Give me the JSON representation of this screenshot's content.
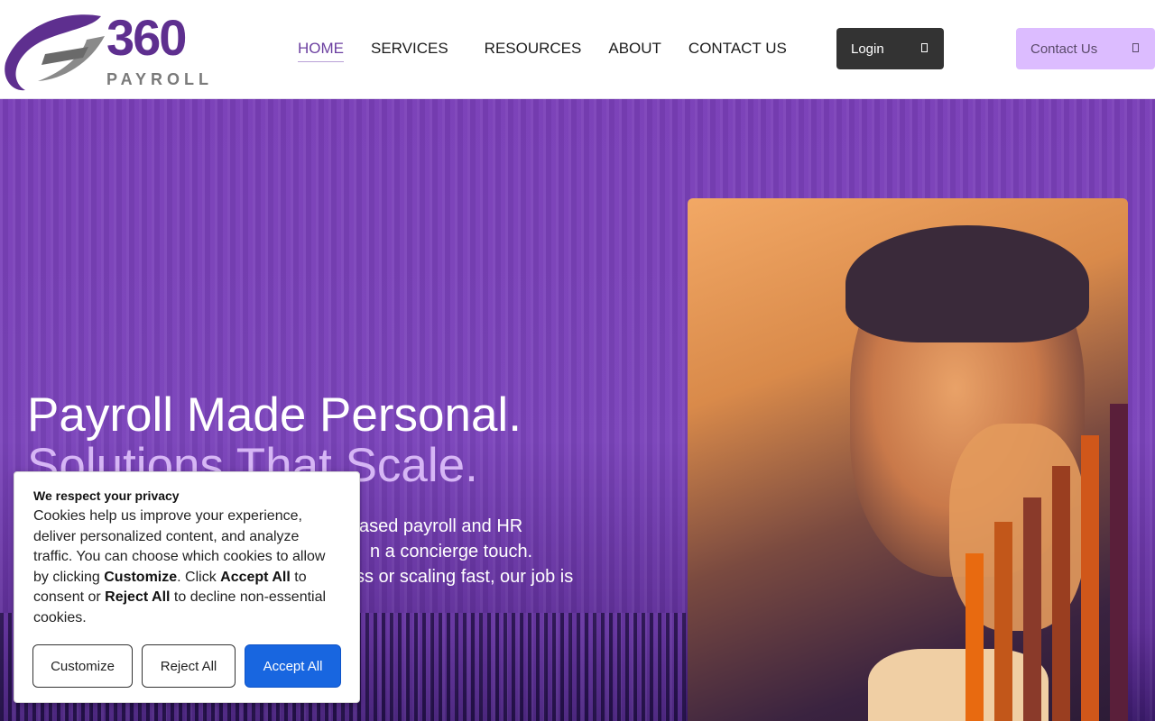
{
  "brand": {
    "number": "360",
    "word": "PAYROLL",
    "primary": "#5e2f8f",
    "accent": "#dcbcff"
  },
  "nav": {
    "items": [
      {
        "label": "HOME",
        "active": true
      },
      {
        "label": "SERVICES",
        "active": false
      },
      {
        "label": "RESOURCES",
        "active": false
      },
      {
        "label": "ABOUT",
        "active": false
      },
      {
        "label": "CONTACT US",
        "active": false
      }
    ],
    "login_label": "Login",
    "login_icon": "square-icon",
    "contact_label": "Contact Us",
    "contact_icon": "square-icon"
  },
  "hero": {
    "title": "Payroll Made Personal.",
    "subtitle": "Solutions That Scale.",
    "body_line1": "ased payroll and HR",
    "body_line2": "n a concierge touch.",
    "body_line3": "ss or scaling fast, our job is"
  },
  "cookie": {
    "title": "We respect your privacy",
    "text_start": "Cookies help us improve your experience, deliver personalized content, and analyze traffic. You can choose which cookies to allow by clicking ",
    "customize_word": "Customize",
    "text_mid1": ". Click ",
    "accept_word": "Accept All",
    "text_mid2": " to consent or ",
    "reject_word": "Reject All",
    "text_end": " to decline non-essential cookies.",
    "customize_button": "Customize",
    "reject_button": "Reject All",
    "accept_button": "Accept All"
  },
  "bars": [
    {
      "color": "#e86a10",
      "level": 0.27
    },
    {
      "color": "#c2571a",
      "level": 0.32
    },
    {
      "color": "#8a3a2a",
      "level": 0.36
    },
    {
      "color": "#9a3e20",
      "level": 0.41
    },
    {
      "color": "#d0571a",
      "level": 0.46
    },
    {
      "color": "#5a1f3a",
      "level": 0.51
    }
  ]
}
